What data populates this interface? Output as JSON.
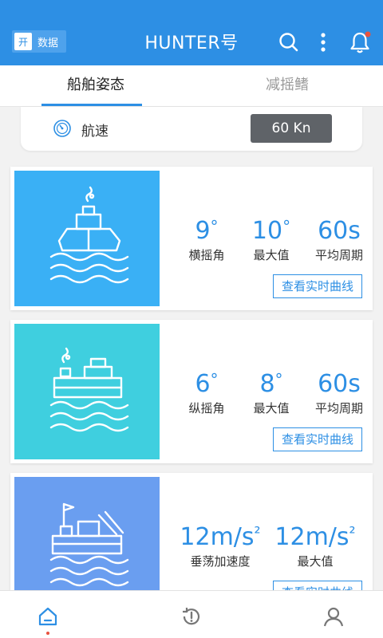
{
  "header": {
    "toggle_on": "开",
    "toggle_label": "数据",
    "title": "HUNTER号"
  },
  "tabs": [
    {
      "label": "船舶姿态",
      "active": true
    },
    {
      "label": "减摇鳍",
      "active": false
    }
  ],
  "speed": {
    "label": "航速",
    "value": "60 Kn"
  },
  "cards": [
    {
      "image_color": "#3ab0f5",
      "icon": "ship-bow-icon",
      "stats": [
        {
          "value": "9°",
          "label": "横摇角"
        },
        {
          "value": "10°",
          "label": "最大值"
        },
        {
          "value": "60s",
          "label": "平均周期"
        }
      ],
      "button": "查看实时曲线"
    },
    {
      "image_color": "#3fcfdf",
      "icon": "cargo-ship-icon",
      "stats": [
        {
          "value": "6°",
          "label": "纵摇角"
        },
        {
          "value": "8°",
          "label": "最大值"
        },
        {
          "value": "60s",
          "label": "平均周期"
        }
      ],
      "button": "查看实时曲线"
    },
    {
      "image_color": "#6a9ef0",
      "icon": "work-ship-icon",
      "stats": [
        {
          "value": "12m/s²",
          "label": "垂荡加速度"
        },
        {
          "value": "12m/s²",
          "label": "最大值"
        }
      ],
      "button": "查看实时曲线"
    }
  ],
  "bottom_nav": [
    {
      "icon": "home-icon",
      "active": true
    },
    {
      "icon": "alert-history-icon",
      "active": false
    },
    {
      "icon": "user-icon",
      "active": false
    }
  ],
  "colors": {
    "accent": "#2d8fe4",
    "notification_dot": "#e8523f"
  }
}
